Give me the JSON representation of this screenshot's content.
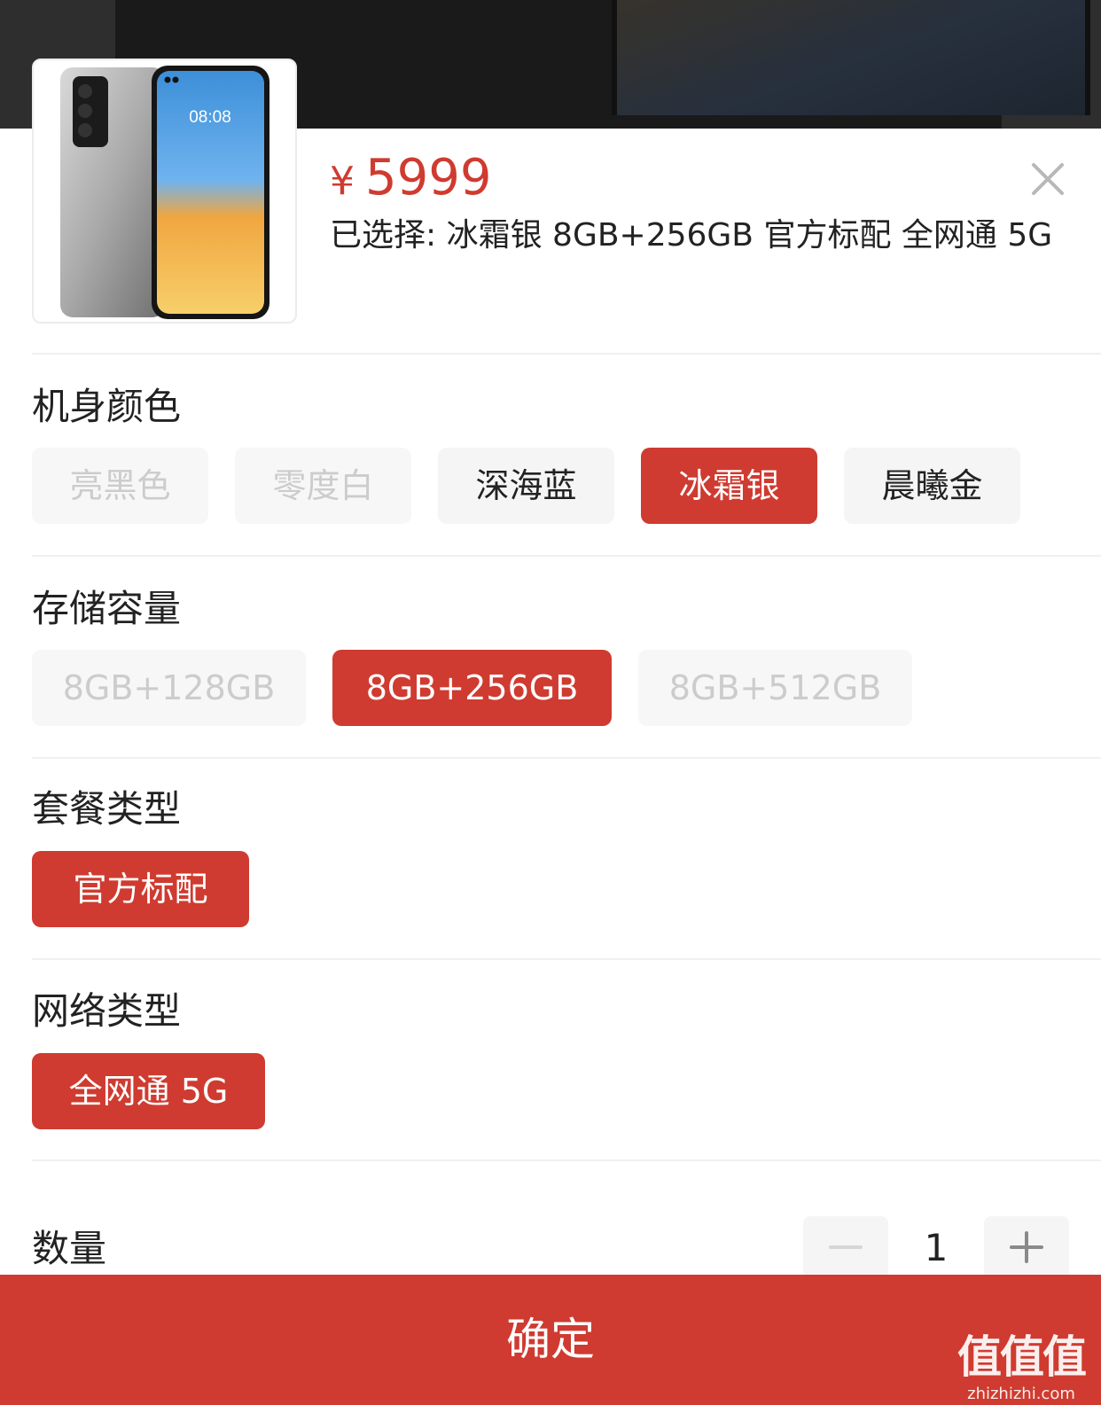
{
  "product": {
    "currency": "¥",
    "price": "5999",
    "selected_prefix": "已选择:",
    "selected_value": "冰霜银 8GB+256GB 官方标配 全网通 5G",
    "thumb_screen_time": "08:08"
  },
  "groups": [
    {
      "title": "机身颜色",
      "options": [
        {
          "label": "亮黑色",
          "state": "disabled"
        },
        {
          "label": "零度白",
          "state": "disabled"
        },
        {
          "label": "深海蓝",
          "state": "normal"
        },
        {
          "label": "冰霜银",
          "state": "selected"
        },
        {
          "label": "晨曦金",
          "state": "normal"
        }
      ]
    },
    {
      "title": "存储容量",
      "options": [
        {
          "label": "8GB+128GB",
          "state": "disabled"
        },
        {
          "label": "8GB+256GB",
          "state": "selected"
        },
        {
          "label": "8GB+512GB",
          "state": "disabled"
        }
      ]
    },
    {
      "title": "套餐类型",
      "options": [
        {
          "label": "官方标配",
          "state": "selected"
        }
      ]
    },
    {
      "title": "网络类型",
      "options": [
        {
          "label": "全网通 5G",
          "state": "selected"
        }
      ]
    }
  ],
  "quantity": {
    "label": "数量",
    "value": "1"
  },
  "confirm_label": "确定",
  "watermark": {
    "logo": "值值值",
    "url": "zhizhizhi.com"
  },
  "colors": {
    "accent": "#cf3b30",
    "chip_bg": "#f5f5f5",
    "disabled_text": "#cccccc"
  },
  "icons": {
    "close": "close-icon",
    "minus": "minus-icon",
    "plus": "plus-icon"
  }
}
